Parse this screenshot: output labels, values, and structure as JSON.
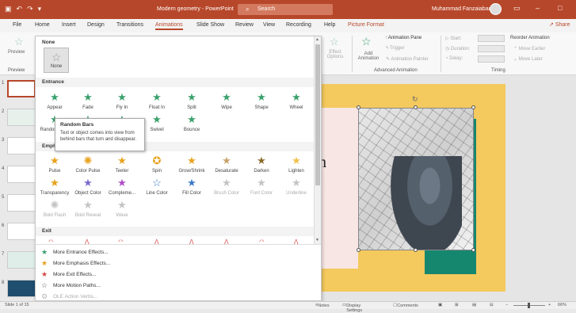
{
  "titlebar": {
    "doc_title": "Modern geometry - PowerPoint",
    "search_placeholder": "Search",
    "user_name": "Muhammad Fanzaiabadi",
    "accent": "#b7472a"
  },
  "tabs": [
    "File",
    "Home",
    "Insert",
    "Design",
    "Transitions",
    "Animations",
    "Slide Show",
    "Review",
    "View",
    "Recording",
    "Help",
    "Picture Format"
  ],
  "active_tab": "Animations",
  "share_label": "Share",
  "ribbon": {
    "preview_label": "Preview",
    "preview_group": "Preview",
    "effect_options": "Effect Options",
    "add_animation": "Add Animation",
    "animation_pane": "Animation Pane",
    "trigger": "Trigger",
    "animation_painter": "Animation Painter",
    "advanced_group": "Advanced Animation",
    "start_label": "Start:",
    "duration_label": "Duration:",
    "delay_label": "Delay:",
    "reorder_label": "Reorder Animation",
    "move_earlier": "Move Earlier",
    "move_later": "Move Later",
    "timing_group": "Timing"
  },
  "gallery": {
    "none_section": "None",
    "none_label": "None",
    "entrance_section": "Entrance",
    "entrance": [
      "Appear",
      "Fade",
      "Fly In",
      "Float In",
      "Split",
      "Wipe",
      "Shape",
      "Wheel"
    ],
    "entrance2": [
      "Random Bars",
      "",
      "",
      "Swivel",
      "Bounce"
    ],
    "emphasis_section": "Emphasis",
    "emphasis": [
      "Pulse",
      "Color Pulse",
      "Teeter",
      "Spin",
      "Grow/Shrink",
      "Desaturate",
      "Darken",
      "Lighten"
    ],
    "emphasis2": [
      "Transparency",
      "Object Color",
      "Compleme...",
      "Line Color",
      "Fill Color",
      "Brush Color",
      "Font Color",
      "Underline"
    ],
    "emphasis3": [
      "Bold Flash",
      "Bold Reveal",
      "Wave"
    ],
    "exit_section": "Exit",
    "more_items": [
      "More Entrance Effects...",
      "More Emphasis Effects...",
      "More Exit Effects...",
      "More Motion Paths...",
      "OLE Action Verbs..."
    ]
  },
  "tooltip": {
    "title": "Random Bars",
    "body": "Text or object comes into view from behind bars that turn and disappear."
  },
  "slides": {
    "numbers": [
      "1",
      "2",
      "3",
      "4",
      "5",
      "6",
      "7",
      "8"
    ]
  },
  "slide_text_fragment": "n",
  "status": {
    "slide_count": "Slide 1 of 15",
    "notes": "Notes",
    "display_settings": "Display Settings",
    "comments": "Comments",
    "zoom": "66%"
  }
}
